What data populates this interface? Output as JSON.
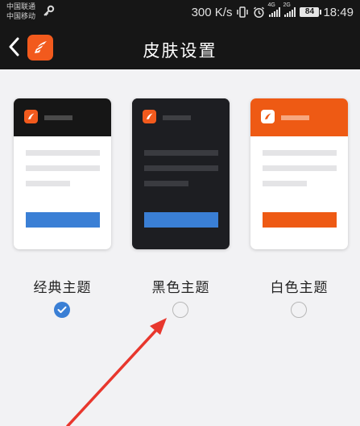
{
  "status_bar": {
    "carrier_1": "中国联通",
    "carrier_2": "中国移动",
    "net_speed": "300 K/s",
    "signal_1_tag": "4G",
    "signal_2_tag": "2G",
    "battery": "84",
    "time": "18:49"
  },
  "header": {
    "title": "皮肤设置",
    "logo_color": "#f25a1d"
  },
  "themes": [
    {
      "label": "经典主题",
      "selected": true,
      "button_color": "#3a7fd5"
    },
    {
      "label": "黑色主题",
      "selected": false,
      "button_color": "#3a7fd5"
    },
    {
      "label": "白色主题",
      "selected": false,
      "button_color": "#ee5a14"
    }
  ],
  "colors": {
    "accent_blue": "#3a7fd5",
    "accent_orange": "#ee5a14",
    "annotation_arrow": "#e8372d"
  }
}
